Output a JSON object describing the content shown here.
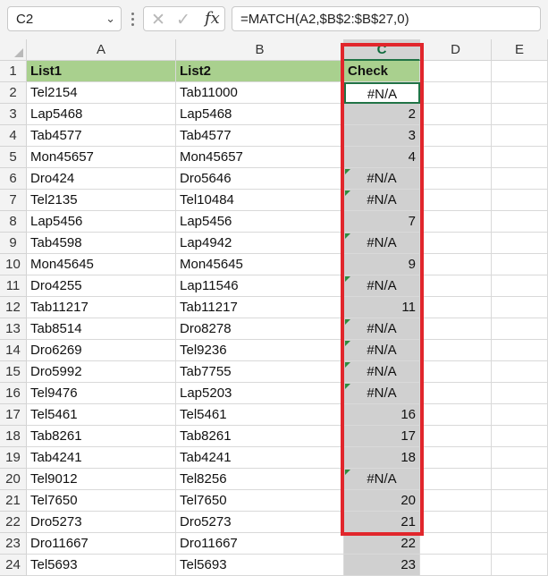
{
  "formula_bar": {
    "name_box": "C2",
    "formula": "=MATCH(A2,$B$2:$B$27,0)",
    "fx_label": "fx"
  },
  "columns": [
    "A",
    "B",
    "C",
    "D",
    "E"
  ],
  "row_numbers": [
    "1",
    "2",
    "3",
    "4",
    "5",
    "6",
    "7",
    "8",
    "9",
    "10",
    "11",
    "12",
    "13",
    "14",
    "15",
    "16",
    "17",
    "18",
    "19",
    "20",
    "21",
    "22",
    "23",
    "24"
  ],
  "header_row": {
    "a": "List1",
    "b": "List2",
    "c": "Check"
  },
  "rows": [
    {
      "a": "Tel2154",
      "b": "Tab11000",
      "c": "#N/A"
    },
    {
      "a": "Lap5468",
      "b": "Lap5468",
      "c": "2"
    },
    {
      "a": "Tab4577",
      "b": "Tab4577",
      "c": "3"
    },
    {
      "a": "Mon45657",
      "b": "Mon45657",
      "c": "4"
    },
    {
      "a": "Dro424",
      "b": "Dro5646",
      "c": "#N/A"
    },
    {
      "a": "Tel2135",
      "b": "Tel10484",
      "c": "#N/A"
    },
    {
      "a": "Lap5456",
      "b": "Lap5456",
      "c": "7"
    },
    {
      "a": "Tab4598",
      "b": "Lap4942",
      "c": "#N/A"
    },
    {
      "a": "Mon45645",
      "b": "Mon45645",
      "c": "9"
    },
    {
      "a": "Dro4255",
      "b": "Lap11546",
      "c": "#N/A"
    },
    {
      "a": "Tab11217",
      "b": "Tab11217",
      "c": "11"
    },
    {
      "a": "Tab8514",
      "b": "Dro8278",
      "c": "#N/A"
    },
    {
      "a": "Dro6269",
      "b": "Tel9236",
      "c": "#N/A"
    },
    {
      "a": "Dro5992",
      "b": "Tab7755",
      "c": "#N/A"
    },
    {
      "a": "Tel9476",
      "b": "Lap5203",
      "c": "#N/A"
    },
    {
      "a": "Tel5461",
      "b": "Tel5461",
      "c": "16"
    },
    {
      "a": "Tab8261",
      "b": "Tab8261",
      "c": "17"
    },
    {
      "a": "Tab4241",
      "b": "Tab4241",
      "c": "18"
    },
    {
      "a": "Tel9012",
      "b": "Tel8256",
      "c": "#N/A"
    },
    {
      "a": "Tel7650",
      "b": "Tel7650",
      "c": "20"
    },
    {
      "a": "Dro5273",
      "b": "Dro5273",
      "c": "21"
    },
    {
      "a": "Dro11667",
      "b": "Dro11667",
      "c": "22"
    },
    {
      "a": "Tel5693",
      "b": "Tel5693",
      "c": "23"
    }
  ],
  "colors": {
    "header_fill": "#a9d08e",
    "result_fill": "#d0d0d0",
    "highlight_border": "#e1262c",
    "selection": "#217346"
  },
  "icons": [
    "cancel-icon",
    "enter-icon",
    "insert-function-icon",
    "dropdown-caret-icon"
  ]
}
